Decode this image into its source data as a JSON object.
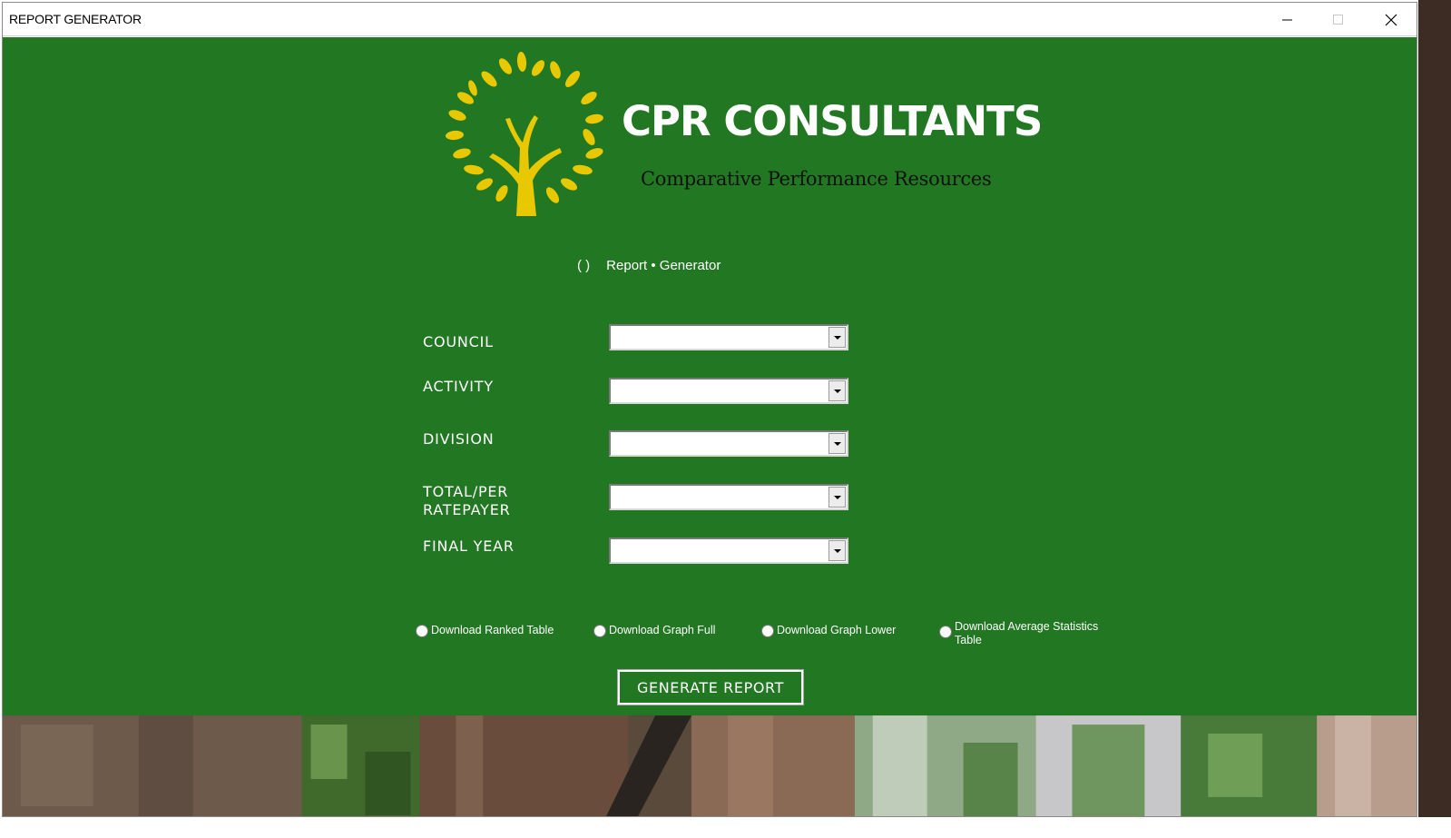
{
  "window": {
    "title": "REPORT GENERATOR"
  },
  "header": {
    "company_name": "CPR CONSULTANTS",
    "tagline": "Comparative Performance Resources",
    "subtitle": "Report • Generator"
  },
  "form": {
    "fields": [
      {
        "label": "COUNCIL",
        "value": ""
      },
      {
        "label": "ACTIVITY",
        "value": ""
      },
      {
        "label": "DIVISION",
        "value": ""
      },
      {
        "label": "TOTAL/PER\nRATEPAYER",
        "value": ""
      },
      {
        "label": "FINAL YEAR",
        "value": ""
      }
    ],
    "options": [
      {
        "label": "Download Ranked Table",
        "checked": false
      },
      {
        "label": "Download Graph Full",
        "checked": false
      },
      {
        "label": "Download Graph Lower",
        "checked": false
      },
      {
        "label": "Download Average Statistics Table",
        "checked": false
      }
    ],
    "generate_label": "GENERATE REPORT"
  },
  "colors": {
    "background": "#227722",
    "logo": "#e8c800",
    "text": "#ffffff",
    "tagline": "#111111"
  },
  "icons": {
    "logo": "tree-logo",
    "spinner": "spinner-icon",
    "dropdown": "chevron-down-icon",
    "minimize": "minimize-icon",
    "maximize": "maximize-icon",
    "close": "close-icon"
  }
}
